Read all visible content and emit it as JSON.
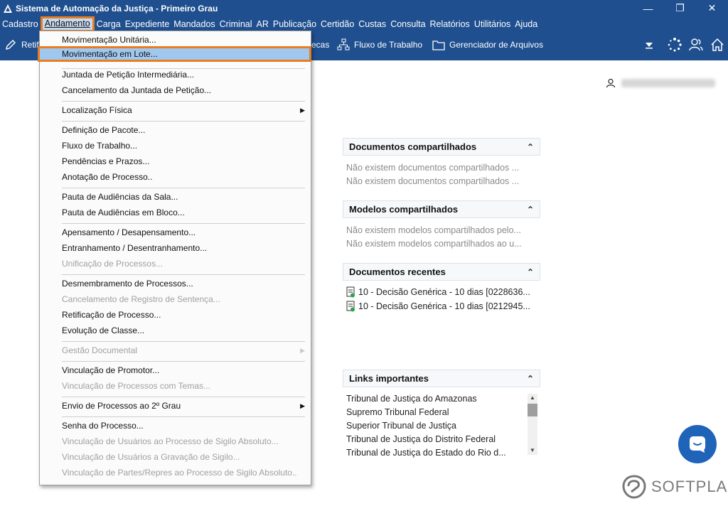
{
  "window": {
    "title": "Sistema de Automação da Justiça - Primeiro Grau",
    "controls": [
      "minimize-icon",
      "restore-icon",
      "close-icon"
    ]
  },
  "menubar": {
    "items": [
      "Cadastro",
      "Andamento",
      "Carga",
      "Expediente",
      "Mandados",
      "Criminal",
      "AR",
      "Publicação",
      "Certidão",
      "Custas",
      "Consulta",
      "Relatórios",
      "Utilitários",
      "Ajuda"
    ],
    "active": "Andamento"
  },
  "toolbar": {
    "partial_left": "Retif",
    "partial_mid": "ecas",
    "fluxo": "Fluxo de Trabalho",
    "gerenciador": "Gerenciador de Arquivos"
  },
  "dropdown": {
    "items": [
      {
        "label": "Movimentação Unitária...",
        "enabled": true
      },
      {
        "label": "Movimentação em Lote...",
        "enabled": true,
        "highlighted": true
      },
      {
        "label": "Juntada de Petição Intermediária...",
        "enabled": true
      },
      {
        "label": "Cancelamento da Juntada de Petição...",
        "enabled": true
      },
      {
        "label": "Localização Física",
        "enabled": true,
        "submenu": true
      },
      {
        "label": "Definição de Pacote...",
        "enabled": true
      },
      {
        "label": "Fluxo de Trabalho...",
        "enabled": true
      },
      {
        "label": "Pendências e Prazos...",
        "enabled": true
      },
      {
        "label": "Anotação de Processo..",
        "enabled": true
      },
      {
        "label": "Pauta de Audiências da Sala...",
        "enabled": true
      },
      {
        "label": "Pauta de Audiências em Bloco...",
        "enabled": true
      },
      {
        "label": "Apensamento / Desapensamento...",
        "enabled": true
      },
      {
        "label": "Entranhamento / Desentranhamento...",
        "enabled": true
      },
      {
        "label": "Unificação de Processos...",
        "enabled": false
      },
      {
        "label": "Desmembramento de Processos...",
        "enabled": true
      },
      {
        "label": "Cancelamento de Registro de Sentença...",
        "enabled": false
      },
      {
        "label": "Retificação de Processo...",
        "enabled": true
      },
      {
        "label": "Evolução de Classe...",
        "enabled": true
      },
      {
        "label": "Gestão Documental",
        "enabled": false,
        "submenu": true
      },
      {
        "label": "Vinculação de Promotor...",
        "enabled": true
      },
      {
        "label": "Vinculação de Processos com Temas...",
        "enabled": false
      },
      {
        "label": "Envio de Processos ao 2º Grau",
        "enabled": true,
        "submenu": true
      },
      {
        "label": "Senha do Processo...",
        "enabled": true
      },
      {
        "label": "Vinculação de Usuários ao Processo de Sigilo Absoluto...",
        "enabled": false
      },
      {
        "label": "Vinculação de Usuários a Gravação de Sigilo...",
        "enabled": false
      },
      {
        "label": "Vinculação de Partes/Repres ao Processo de Sigilo Absoluto..",
        "enabled": false
      }
    ]
  },
  "panels": {
    "docs_shared": {
      "title": "Documentos compartilhados",
      "lines": [
        "Não existem documentos compartilhados ...",
        "Não existem documentos compartilhados ..."
      ]
    },
    "models_shared": {
      "title": "Modelos compartilhados",
      "lines": [
        "Não existem modelos compartilhados pelo...",
        "Não existem modelos compartilhados ao u..."
      ]
    },
    "recent_docs": {
      "title": "Documentos recentes",
      "items": [
        "10 - Decisão Genérica - 10 dias [0228636...",
        "10 - Decisão Genérica - 10 dias [0212945..."
      ]
    },
    "links": {
      "title": "Links importantes",
      "items": [
        "Tribunal de Justiça do Amazonas",
        "Supremo Tribunal Federal",
        "Superior Tribunal de Justiça",
        "Tribunal de Justiça do Distrito Federal",
        "Tribunal de Justiça do Estado do Rio d..."
      ]
    }
  },
  "brand": "SOFTPLAN",
  "colors": {
    "titlebar": "#1f4f8f",
    "highlight": "#9fc7ef",
    "outline": "#e87d1e",
    "chat": "#1f64b8"
  }
}
